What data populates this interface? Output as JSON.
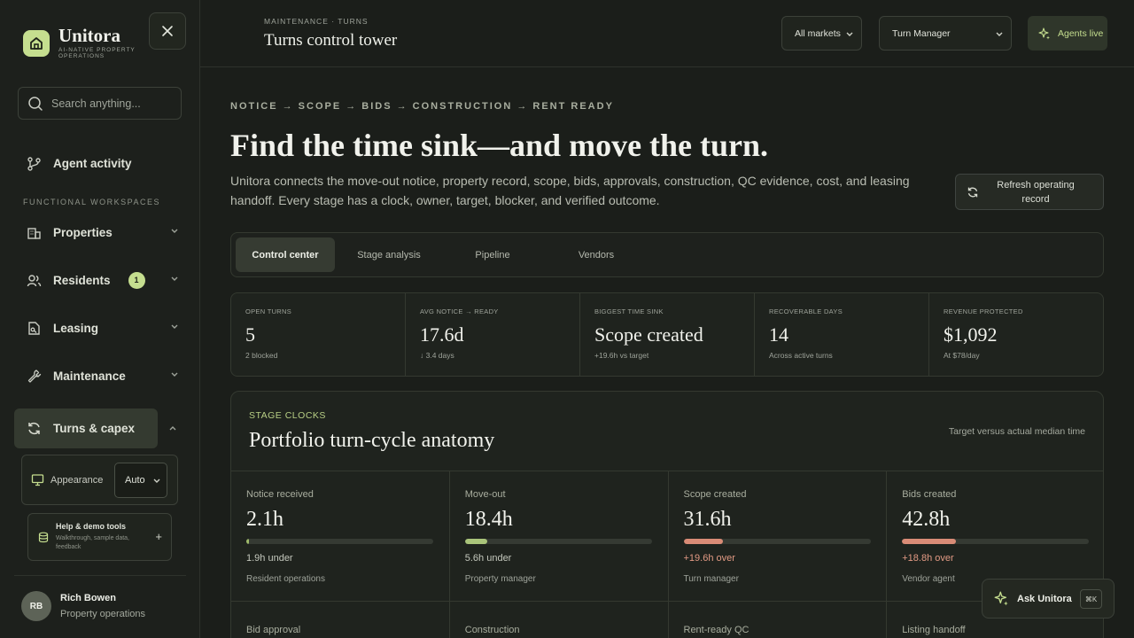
{
  "brand": {
    "name": "Unitora",
    "tagline": "AI-NATIVE PROPERTY OPERATIONS"
  },
  "search": {
    "placeholder": "Search anything..."
  },
  "sidebar": {
    "agent_activity": "Agent activity",
    "section_label": "FUNCTIONAL WORKSPACES",
    "items": [
      {
        "label": "Properties"
      },
      {
        "label": "Residents",
        "badge": "1"
      },
      {
        "label": "Leasing"
      },
      {
        "label": "Maintenance"
      },
      {
        "label": "Turns & capex"
      }
    ],
    "appearance": {
      "label": "Appearance",
      "value": "Auto"
    },
    "help": {
      "title": "Help & demo tools",
      "subtitle": "Walkthrough, sample data, feedback"
    },
    "user": {
      "initials": "RB",
      "name": "Rich Bowen",
      "role": "Property operations"
    }
  },
  "header": {
    "breadcrumb": "MAINTENANCE · TURNS",
    "title": "Turns control tower",
    "market_select": "All markets",
    "role_select": "Turn Manager",
    "agents_live": "Agents live"
  },
  "main": {
    "flow": "NOTICE → SCOPE → BIDS → CONSTRUCTION → RENT READY",
    "hero": "Find the time sink—and move the turn.",
    "intro": "Unitora connects the move-out notice, property record, scope, bids, approvals, construction, QC evidence, cost, and leasing handoff. Every stage has a clock, owner, target, blocker, and verified outcome.",
    "refresh_label": "Refresh operating record",
    "tabs": [
      "Control center",
      "Stage analysis",
      "Pipeline",
      "Vendors"
    ],
    "stats": [
      {
        "label": "OPEN TURNS",
        "value": "5",
        "sub": "2 blocked"
      },
      {
        "label": "AVG NOTICE → READY",
        "value": "17.6d",
        "sub": "↓ 3.4 days"
      },
      {
        "label": "BIGGEST TIME SINK",
        "value": "Scope created",
        "sub": "+19.6h vs target"
      },
      {
        "label": "RECOVERABLE DAYS",
        "value": "14",
        "sub": "Across active turns"
      },
      {
        "label": "REVENUE PROTECTED",
        "value": "$1,092",
        "sub": "At $78/day"
      }
    ],
    "clocks": {
      "eyebrow": "STAGE CLOCKS",
      "title": "Portfolio turn-cycle anatomy",
      "note": "Target versus actual median time",
      "stages": [
        {
          "label": "Notice received",
          "value": "2.1h",
          "progress": 0.01,
          "bar_color": "#9fba6b",
          "delta": "1.9h under",
          "delta_color": "#c4c8bd",
          "owner": "Resident operations"
        },
        {
          "label": "Move-out",
          "value": "18.4h",
          "progress": 0.12,
          "bar_color": "#a9c47a",
          "delta": "5.6h under",
          "delta_color": "#c4c8bd",
          "owner": "Property manager"
        },
        {
          "label": "Scope created",
          "value": "31.6h",
          "progress": 0.21,
          "bar_color": "#d98b76",
          "delta": "+19.6h over",
          "delta_color": "#e29a84",
          "owner": "Turn manager"
        },
        {
          "label": "Bids created",
          "value": "42.8h",
          "progress": 0.29,
          "bar_color": "#d98b76",
          "delta": "+18.8h over",
          "delta_color": "#e29a84",
          "owner": "Vendor agent"
        }
      ],
      "stages_row2": [
        "Bid approval",
        "Construction",
        "Rent-ready QC",
        "Listing handoff"
      ]
    },
    "ask": {
      "label": "Ask Unitora",
      "shortcut": "⌘K"
    }
  }
}
